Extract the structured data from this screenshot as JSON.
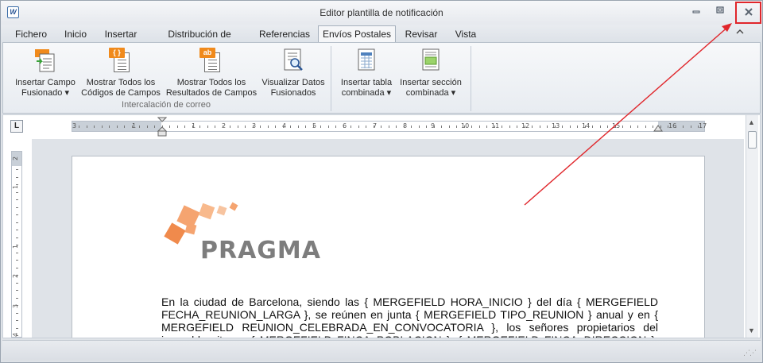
{
  "window": {
    "title": "Editor plantilla de notificación",
    "app_icon": "W"
  },
  "tabs": [
    {
      "label": "Fichero",
      "active": false
    },
    {
      "label": "Inicio",
      "active": false
    },
    {
      "label": "Insertar",
      "active": false
    },
    {
      "label": "Distribución de Página",
      "active": false
    },
    {
      "label": "Referencias",
      "active": false
    },
    {
      "label": "Envíos Postales",
      "active": true
    },
    {
      "label": "Revisar",
      "active": false
    },
    {
      "label": "Vista",
      "active": false
    }
  ],
  "ribbon": {
    "group_label": "Intercalación de correo",
    "buttons": [
      {
        "line1": "Insertar Campo",
        "line2": "Fusionado ▾",
        "icon": "insert-merge-field-icon"
      },
      {
        "line1": "Mostrar Todos los",
        "line2": "Códigos de Campos",
        "icon": "field-codes-icon",
        "badge": "{ }"
      },
      {
        "line1": "Mostrar Todos los",
        "line2": "Resultados de Campos",
        "icon": "field-results-icon",
        "badge": "ab"
      },
      {
        "line1": "Visualizar Datos",
        "line2": "Fusionados",
        "icon": "preview-merged-data-icon"
      },
      {
        "line1": "Insertar tabla",
        "line2": "combinada ▾",
        "icon": "insert-merged-table-icon"
      },
      {
        "line1": "Insertar sección",
        "line2": "combinada ▾",
        "icon": "insert-merged-section-icon"
      }
    ]
  },
  "rulers": {
    "horizontal_labels": [
      "3",
      "1",
      "1",
      "2",
      "3",
      "4",
      "5",
      "6",
      "7",
      "8",
      "9",
      "10",
      "11",
      "12",
      "13",
      "14",
      "15",
      "16",
      "17",
      "18"
    ],
    "vertical_labels": [
      "2",
      "1",
      "1",
      "2",
      "3",
      "4"
    ],
    "tab_selector": "L"
  },
  "document": {
    "logo_text": "PRAGMA",
    "paragraph": "En la ciudad de Barcelona, siendo las { MERGEFIELD HORA_INICIO } del día { MERGEFIELD FECHA_REUNION_LARGA }, se reúnen en junta { MERGEFIELD TIPO_REUNION } anual y en { MERGEFIELD REUNION_CELEBRADA_EN_CONVOCATORIA }, los señores propietarios del inmueble sito en { MERGEFIELD FINCA_POBLACION }, { MERGEFIELD FINCA_DIRECCION }, previamente"
  },
  "colors": {
    "accent_orange": "#f08a1c",
    "highlight_red": "#e0262b"
  }
}
